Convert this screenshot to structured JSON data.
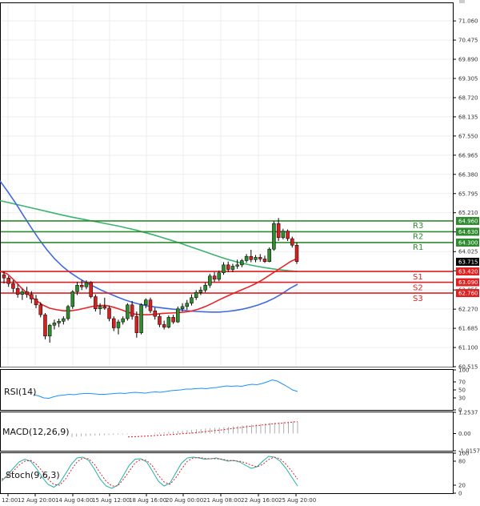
{
  "chart_data": {
    "type": "candlestick",
    "main": {
      "y_ticks": [
        "71.060",
        "70.475",
        "69.890",
        "69.305",
        "68.720",
        "68.135",
        "67.550",
        "66.965",
        "66.380",
        "65.795",
        "65.210",
        "64.625",
        "64.025",
        "63.440",
        "62.855",
        "62.270",
        "61.685",
        "61.100",
        "60.515"
      ],
      "ylim": [
        60.515,
        71.6
      ],
      "candles": [
        [
          63.32,
          63.42,
          63.05,
          63.22
        ],
        [
          63.22,
          63.28,
          62.95,
          63.05
        ],
        [
          63.05,
          63.15,
          62.78,
          62.9
        ],
        [
          62.9,
          63.02,
          62.62,
          62.72
        ],
        [
          62.72,
          62.88,
          62.55,
          62.8
        ],
        [
          62.8,
          62.95,
          62.62,
          62.72
        ],
        [
          62.72,
          62.82,
          62.45,
          62.58
        ],
        [
          62.58,
          62.7,
          62.3,
          62.4
        ],
        [
          62.4,
          62.48,
          62.02,
          62.1
        ],
        [
          62.1,
          62.15,
          61.35,
          61.45
        ],
        [
          61.45,
          61.82,
          61.25,
          61.78
        ],
        [
          61.78,
          61.95,
          61.65,
          61.85
        ],
        [
          61.85,
          61.98,
          61.72,
          61.9
        ],
        [
          61.9,
          62.05,
          61.8,
          61.98
        ],
        [
          61.98,
          62.4,
          61.92,
          62.35
        ],
        [
          62.35,
          62.85,
          62.28,
          62.8
        ],
        [
          62.8,
          63.1,
          62.7,
          63.0
        ],
        [
          63.0,
          63.15,
          62.85,
          62.95
        ],
        [
          62.95,
          63.15,
          62.88,
          63.08
        ],
        [
          63.08,
          63.12,
          62.6,
          62.65
        ],
        [
          62.65,
          62.72,
          62.2,
          62.28
        ],
        [
          62.28,
          62.45,
          62.1,
          62.35
        ],
        [
          62.35,
          62.62,
          62.25,
          62.3
        ],
        [
          62.3,
          62.38,
          61.9,
          61.98
        ],
        [
          61.98,
          62.05,
          61.6,
          61.7
        ],
        [
          61.7,
          61.95,
          61.5,
          61.88
        ],
        [
          61.88,
          62.05,
          61.8,
          61.98
        ],
        [
          61.98,
          62.45,
          61.92,
          62.4
        ],
        [
          62.4,
          62.52,
          61.95,
          62.05
        ],
        [
          62.05,
          62.2,
          61.4,
          61.55
        ],
        [
          61.55,
          62.45,
          61.5,
          62.4
        ],
        [
          62.4,
          62.6,
          62.3,
          62.55
        ],
        [
          62.55,
          62.62,
          62.15,
          62.22
        ],
        [
          62.22,
          62.32,
          61.95,
          62.05
        ],
        [
          62.05,
          62.12,
          61.72,
          61.8
        ],
        [
          61.8,
          61.92,
          61.65,
          61.72
        ],
        [
          61.72,
          62.08,
          61.68,
          62.02
        ],
        [
          62.02,
          62.1,
          61.82,
          61.88
        ],
        [
          61.88,
          62.35,
          61.85,
          62.28
        ],
        [
          62.28,
          62.45,
          62.2,
          62.35
        ],
        [
          62.35,
          62.55,
          62.25,
          62.45
        ],
        [
          62.45,
          62.72,
          62.38,
          62.62
        ],
        [
          62.62,
          62.85,
          62.55,
          62.78
        ],
        [
          62.78,
          62.95,
          62.7,
          62.85
        ],
        [
          62.85,
          63.08,
          62.78,
          63.0
        ],
        [
          63.0,
          63.35,
          62.92,
          63.28
        ],
        [
          63.28,
          63.4,
          63.1,
          63.18
        ],
        [
          63.18,
          63.45,
          63.12,
          63.38
        ],
        [
          63.38,
          63.7,
          63.32,
          63.62
        ],
        [
          63.62,
          63.72,
          63.4,
          63.48
        ],
        [
          63.48,
          63.65,
          63.4,
          63.58
        ],
        [
          63.58,
          63.78,
          63.5,
          63.62
        ],
        [
          63.62,
          63.8,
          63.55,
          63.75
        ],
        [
          63.75,
          63.95,
          63.68,
          63.88
        ],
        [
          63.88,
          64.08,
          63.7,
          63.78
        ],
        [
          63.78,
          63.92,
          63.7,
          63.85
        ],
        [
          63.85,
          63.95,
          63.72,
          63.8
        ],
        [
          63.8,
          63.9,
          63.68,
          63.72
        ],
        [
          63.72,
          64.15,
          63.7,
          64.1
        ],
        [
          64.1,
          64.95,
          64.05,
          64.88
        ],
        [
          64.88,
          65.05,
          64.35,
          64.45
        ],
        [
          64.45,
          64.72,
          64.4,
          64.65
        ],
        [
          64.65,
          64.7,
          64.35,
          64.42
        ],
        [
          64.42,
          64.48,
          64.15,
          64.22
        ],
        [
          64.22,
          64.3,
          63.65,
          63.72
        ]
      ],
      "ma_green": [
        65.58,
        65.52,
        65.46,
        65.4,
        65.34,
        65.28,
        65.22,
        65.16,
        65.1,
        65.05,
        65.0,
        64.95,
        64.9,
        64.85,
        64.8,
        64.74,
        64.68,
        64.61,
        64.54,
        64.46,
        64.38,
        64.3,
        64.21,
        64.12,
        64.03,
        63.94,
        63.85,
        63.77,
        63.7,
        63.64,
        63.59,
        63.54,
        63.5,
        63.47,
        63.44,
        63.42
      ],
      "ma_blue": [
        66.18,
        65.85,
        65.5,
        65.12,
        64.75,
        64.4,
        64.08,
        63.8,
        63.57,
        63.38,
        63.22,
        63.08,
        62.96,
        62.84,
        62.74,
        62.64,
        62.55,
        62.47,
        62.41,
        62.36,
        62.33,
        62.3,
        62.27,
        62.25,
        62.22,
        62.2,
        62.19,
        62.18,
        62.18,
        62.2,
        62.23,
        62.27,
        62.33,
        62.4,
        62.49,
        62.6,
        62.74,
        62.9,
        63.03
      ],
      "ma_red": [
        63.42,
        63.35,
        63.15,
        62.92,
        62.72,
        62.55,
        62.4,
        62.3,
        62.25,
        62.22,
        62.22,
        62.25,
        62.3,
        62.35,
        62.38,
        62.38,
        62.33,
        62.26,
        62.18,
        62.12,
        62.1,
        62.1,
        62.12,
        62.14,
        62.15,
        62.16,
        62.18,
        62.21,
        62.27,
        62.35,
        62.45,
        62.56,
        62.66,
        62.76,
        62.85,
        62.94,
        63.04,
        63.16,
        63.3,
        63.44,
        63.58,
        63.72,
        63.82
      ],
      "levels": [
        {
          "label": "R3",
          "value": 64.96,
          "tag": "64.960",
          "kind": "resistance"
        },
        {
          "label": "R2",
          "value": 64.63,
          "tag": "64.630",
          "kind": "resistance"
        },
        {
          "label": "R1",
          "value": 64.3,
          "tag": "64.300",
          "kind": "resistance"
        },
        {
          "label": "S1",
          "value": 63.42,
          "tag": "63.420",
          "kind": "support"
        },
        {
          "label": "S2",
          "value": 63.09,
          "tag": "63.090",
          "kind": "support"
        },
        {
          "label": "S3",
          "value": 62.76,
          "tag": "62.760",
          "kind": "support"
        }
      ],
      "current_price": "63.715"
    },
    "rsi": {
      "label": "RSI(14)",
      "y_ticks": [
        "100",
        "70",
        "50",
        "30",
        "0"
      ],
      "values": [
        38,
        35,
        30,
        29,
        33,
        36,
        37,
        39,
        38,
        40,
        41,
        41,
        40,
        39,
        39,
        40,
        41,
        42,
        41,
        43,
        44,
        43,
        42,
        44,
        45,
        44,
        46,
        48,
        49,
        50,
        52,
        52,
        53,
        54,
        53,
        55,
        56,
        58,
        60,
        59,
        60,
        59,
        62,
        64,
        63,
        66,
        70,
        75,
        72,
        65,
        58,
        50,
        46
      ]
    },
    "macd": {
      "label": "MACD(12,26,9)",
      "y_ticks": [
        "1.2537",
        "0.00",
        "-1.0157"
      ],
      "values": [
        -0.22,
        -0.18,
        -0.15,
        -0.14,
        -0.13,
        -0.12,
        -0.11,
        -0.1,
        -0.08,
        -0.07,
        -0.06,
        -0.05,
        -0.04,
        -0.03,
        -0.02,
        -0.01,
        0.0,
        0.02,
        0.04,
        0.06,
        0.08,
        0.1,
        0.12,
        0.15,
        0.17,
        0.2,
        0.22,
        0.25,
        0.27,
        0.3,
        0.32,
        0.34,
        0.36,
        0.38,
        0.4,
        0.42,
        0.45,
        0.48,
        0.5,
        0.52,
        0.55,
        0.58,
        0.6,
        0.62,
        0.64,
        0.66,
        0.68,
        0.7,
        0.72,
        0.7
      ],
      "signal": [
        -0.2,
        -0.19,
        -0.18,
        -0.16,
        -0.15,
        -0.13,
        -0.11,
        -0.1,
        -0.08,
        -0.06,
        -0.04,
        -0.02,
        0.0,
        0.02,
        0.04,
        0.07,
        0.1,
        0.13,
        0.16,
        0.19,
        0.22,
        0.26,
        0.29,
        0.33,
        0.36,
        0.4,
        0.43,
        0.46,
        0.49,
        0.52,
        0.55,
        0.58,
        0.6,
        0.63,
        0.65,
        0.68,
        0.7
      ]
    },
    "stoch": {
      "label": "Stoch(9,6,3)",
      "y_ticks": [
        "100",
        "80",
        "20",
        "0"
      ],
      "k": [
        30,
        45,
        62,
        78,
        85,
        80,
        62,
        40,
        22,
        15,
        25,
        48,
        72,
        88,
        90,
        82,
        60,
        35,
        18,
        12,
        20,
        45,
        70,
        85,
        86,
        78,
        55,
        30,
        18,
        25,
        50,
        75,
        88,
        90,
        88,
        85,
        86,
        88,
        84,
        80,
        82,
        78,
        70,
        62,
        66,
        80,
        92,
        90,
        80,
        62,
        40,
        18
      ],
      "d": [
        35,
        42,
        55,
        70,
        80,
        82,
        72,
        55,
        35,
        22,
        20,
        35,
        58,
        78,
        88,
        86,
        72,
        50,
        30,
        18,
        18,
        35,
        55,
        76,
        84,
        82,
        68,
        45,
        28,
        22,
        38,
        60,
        80,
        88,
        89,
        87,
        86,
        86,
        85,
        82,
        81,
        80,
        76,
        70,
        66,
        72,
        84,
        90,
        86,
        72,
        55,
        35
      ]
    },
    "x_ticks": [
      "12:00",
      "12 Aug 20:00",
      "14 Aug 04:00",
      "15 Aug 12:00",
      "18 Aug 16:00",
      "20 Aug 00:00",
      "21 Aug 08:00",
      "22 Aug 16:00",
      "25 Aug 20:00"
    ],
    "colors": {
      "ma_green": "#3cb371",
      "ma_blue": "#4169e1",
      "ma_red": "#e8242a",
      "bull": "#2e8b2e",
      "bear": "#d62020",
      "resistance": "#2e8b2e",
      "support": "#e02020",
      "rsi": "#1e90ff",
      "macd": "#e02020",
      "stoch_k": "#20b2aa",
      "stoch_d": "#e02020",
      "current_tag": "#000000"
    }
  }
}
